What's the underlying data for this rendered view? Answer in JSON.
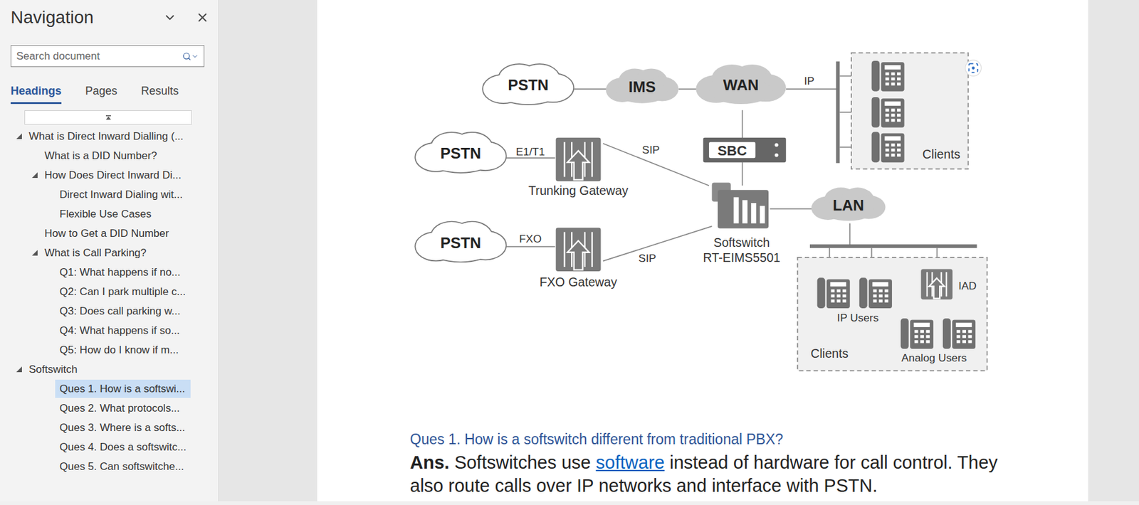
{
  "navigation": {
    "title": "Navigation",
    "search": {
      "placeholder": "Search document"
    },
    "tabs": [
      {
        "label": "Headings",
        "selected": true
      },
      {
        "label": "Pages",
        "selected": false
      },
      {
        "label": "Results",
        "selected": false
      }
    ],
    "headings": [
      {
        "text": "What is Direct Inward Dialling (...",
        "level": 0,
        "expanded": true,
        "selected": false
      },
      {
        "text": "What is a DID Number?",
        "level": 1,
        "expanded": false,
        "selected": false
      },
      {
        "text": "How Does Direct Inward Di...",
        "level": 1,
        "expanded": true,
        "selected": false
      },
      {
        "text": "Direct Inward Dialing wit...",
        "level": 2,
        "expanded": false,
        "selected": false
      },
      {
        "text": "Flexible Use Cases",
        "level": 2,
        "expanded": false,
        "selected": false
      },
      {
        "text": "How to Get a DID Number",
        "level": 1,
        "expanded": false,
        "selected": false
      },
      {
        "text": "What is Call Parking?",
        "level": 1,
        "expanded": true,
        "selected": false
      },
      {
        "text": "Q1: What happens if no...",
        "level": 2,
        "expanded": false,
        "selected": false
      },
      {
        "text": "Q2: Can I park multiple c...",
        "level": 2,
        "expanded": false,
        "selected": false
      },
      {
        "text": "Q3: Does call parking w...",
        "level": 2,
        "expanded": false,
        "selected": false
      },
      {
        "text": "Q4: What happens if so...",
        "level": 2,
        "expanded": false,
        "selected": false
      },
      {
        "text": "Q5: How do I know if m...",
        "level": 2,
        "expanded": false,
        "selected": false
      },
      {
        "text": "Softswitch",
        "level": 0,
        "expanded": true,
        "selected": false
      },
      {
        "text": "Ques 1. How is a softswi...",
        "level": 2,
        "expanded": false,
        "selected": true
      },
      {
        "text": "Ques 2. What protocols...",
        "level": 2,
        "expanded": false,
        "selected": false
      },
      {
        "text": "Ques 3. Where is a softs...",
        "level": 2,
        "expanded": false,
        "selected": false
      },
      {
        "text": "Ques 4. Does a softswitc...",
        "level": 2,
        "expanded": false,
        "selected": false
      },
      {
        "text": "Ques 5. Can softswitche...",
        "level": 2,
        "expanded": false,
        "selected": false
      }
    ]
  },
  "document": {
    "diagram": {
      "clouds": [
        {
          "label": "PSTN",
          "color": "#ffffff"
        },
        {
          "label": "IMS",
          "color": "#c9c9c9"
        },
        {
          "label": "WAN",
          "color": "#c9c9c9"
        },
        {
          "label": "PSTN",
          "color": "#ffffff"
        },
        {
          "label": "PSTN",
          "color": "#ffffff"
        },
        {
          "label": "LAN",
          "color": "#c9c9c9"
        }
      ],
      "link_labels": [
        "IP",
        "E1/T1",
        "SIP",
        "FXO",
        "SIP"
      ],
      "sbc": "SBC",
      "softswitch": [
        "Softswitch",
        "RT-EIMS5501"
      ],
      "gateways": [
        "Trunking Gateway",
        "FXO Gateway"
      ],
      "iad": "IAD",
      "clients": [
        "Clients",
        "Clients"
      ],
      "user_groups": [
        "IP Users",
        "Analog Users"
      ]
    },
    "question": "Ques 1. How is a softswitch different from traditional PBX?",
    "answer": {
      "label": "Ans.",
      "before": " Softswitches use ",
      "link": "software",
      "after": " instead of hardware for call control. They also route calls over IP networks and interface with PSTN."
    }
  }
}
